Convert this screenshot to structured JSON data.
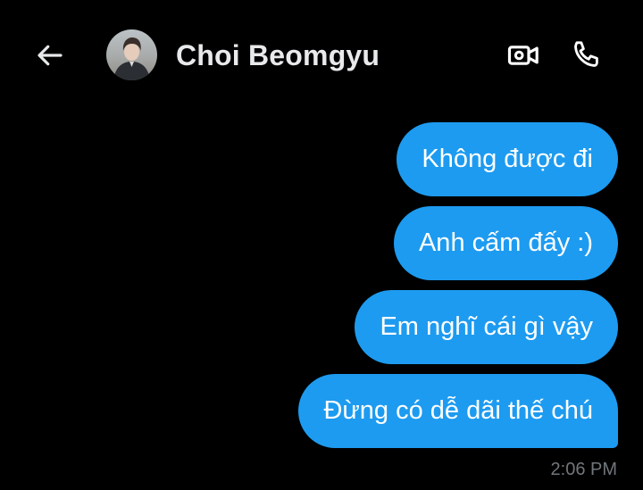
{
  "header": {
    "contact_name": "Choi Beomgyu"
  },
  "icons": {
    "back": "arrow-left-icon",
    "video": "video-camera-icon",
    "call": "phone-icon"
  },
  "colors": {
    "background": "#000000",
    "bubble": "#1d9bf0",
    "bubble_text": "#ffffff",
    "name_text": "#e7e9ea",
    "timestamp_text": "#71767b"
  },
  "messages": [
    {
      "text": "Không được đi",
      "sender": "me"
    },
    {
      "text": "Anh cấm đấy :)",
      "sender": "me"
    },
    {
      "text": "Em nghĩ cái gì vậy",
      "sender": "me"
    },
    {
      "text": "Đừng có dễ dãi thế chú",
      "sender": "me"
    }
  ],
  "timestamp": "2:06 PM"
}
